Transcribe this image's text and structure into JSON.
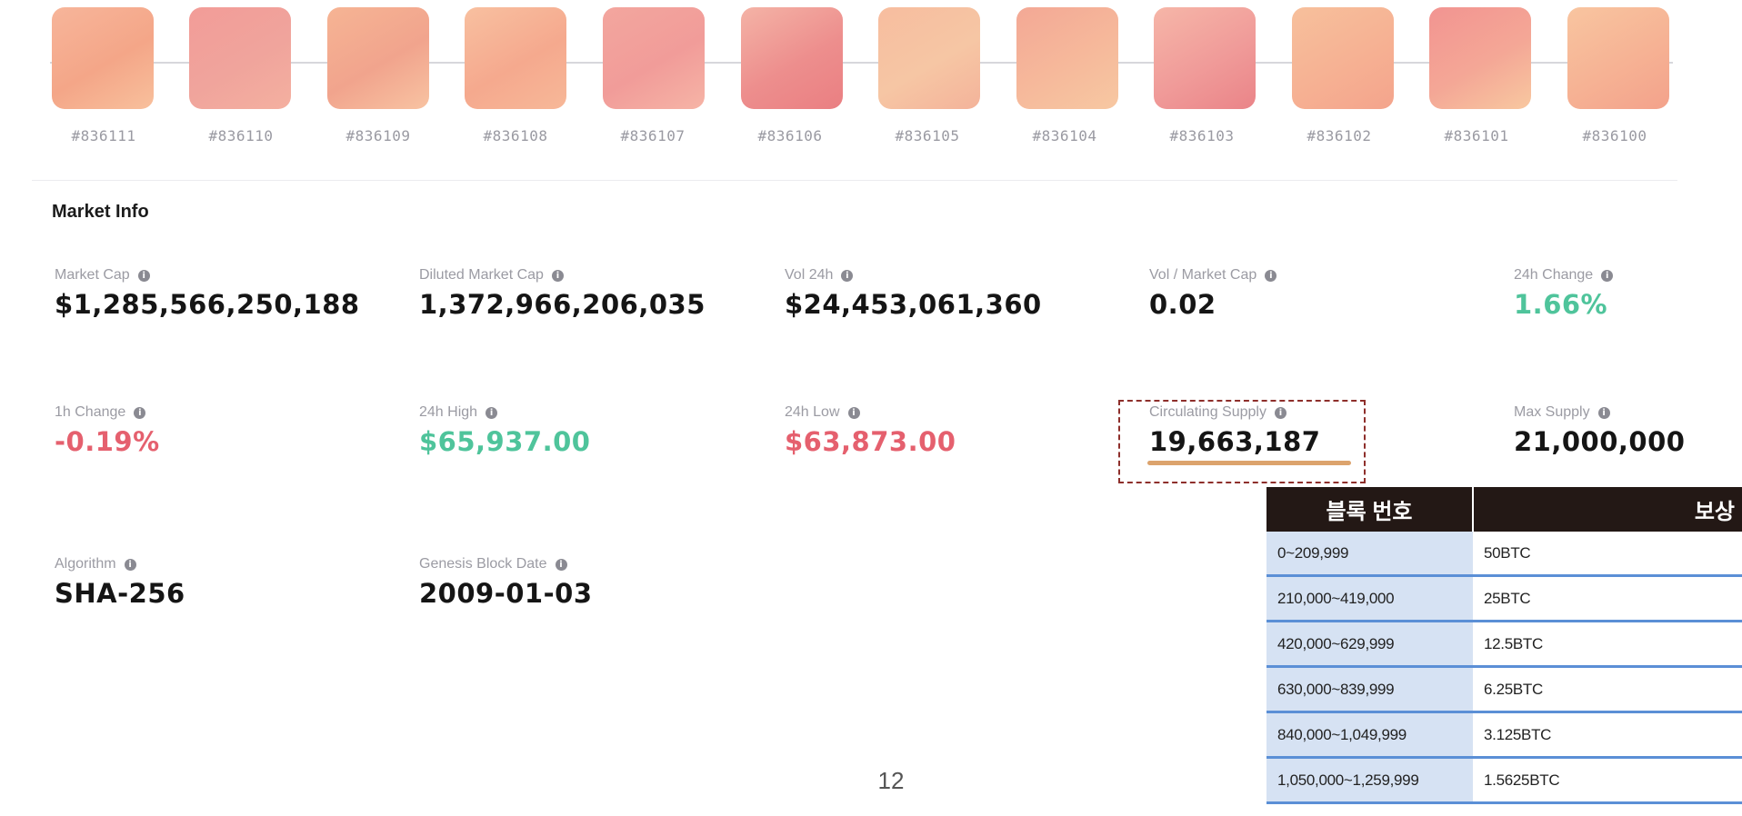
{
  "colors": {
    "swatch_line": "#d7d7dc",
    "positive": "#4fc49b",
    "negative": "#e5606e",
    "highlight_border": "#8e2f2b",
    "supply_bar": "#dca36d",
    "table_header_bg": "#231815",
    "table_block_bg": "#d6e2f3",
    "table_row_border": "#5b8fd6"
  },
  "swatches": [
    {
      "label": "#836111",
      "gradient": [
        "#f7b59a",
        "#f4a688",
        "#f8c09c"
      ]
    },
    {
      "label": "#836110",
      "gradient": [
        "#f29c98",
        "#f0a49c",
        "#f4b0a0"
      ]
    },
    {
      "label": "#836109",
      "gradient": [
        "#f6b494",
        "#f1a48d",
        "#f8c3a2"
      ]
    },
    {
      "label": "#836108",
      "gradient": [
        "#f8c0a0",
        "#f5a98e",
        "#f7b898"
      ]
    },
    {
      "label": "#836107",
      "gradient": [
        "#f3a69e",
        "#f19c99",
        "#f6b4a6"
      ]
    },
    {
      "label": "#836106",
      "gradient": [
        "#f4b3a6",
        "#ed8e8d",
        "#ea7f82"
      ]
    },
    {
      "label": "#836105",
      "gradient": [
        "#f7bd9f",
        "#f6c6a4",
        "#f4b39a"
      ]
    },
    {
      "label": "#836104",
      "gradient": [
        "#f3a895",
        "#f6b99b",
        "#f7c8a2"
      ]
    },
    {
      "label": "#836103",
      "gradient": [
        "#f6b6a8",
        "#f09b99",
        "#ea8488"
      ]
    },
    {
      "label": "#836102",
      "gradient": [
        "#f7c09c",
        "#f6b193",
        "#f4a48c"
      ]
    },
    {
      "label": "#836101",
      "gradient": [
        "#f29491",
        "#f4a796",
        "#f8c8a0"
      ]
    },
    {
      "label": "#836100",
      "gradient": [
        "#f8c5a0",
        "#f6b294",
        "#f3a28b"
      ]
    }
  ],
  "market_info": {
    "title": "Market Info",
    "stats": [
      {
        "label": "Market Cap",
        "value": "$1,285,566,250,188",
        "tone": "default"
      },
      {
        "label": "Diluted Market Cap",
        "value": "1,372,966,206,035",
        "tone": "default"
      },
      {
        "label": "Vol 24h",
        "value": "$24,453,061,360",
        "tone": "default"
      },
      {
        "label": "Vol / Market Cap",
        "value": "0.02",
        "tone": "default"
      },
      {
        "label": "24h Change",
        "value": "1.66%",
        "tone": "positive"
      },
      {
        "label": "1h Change",
        "value": "-0.19%",
        "tone": "negative"
      },
      {
        "label": "24h High",
        "value": "$65,937.00",
        "tone": "positive"
      },
      {
        "label": "24h Low",
        "value": "$63,873.00",
        "tone": "negative"
      },
      {
        "label": "Circulating Supply",
        "value": "19,663,187",
        "tone": "default"
      },
      {
        "label": "Max Supply",
        "value": "21,000,000",
        "tone": "default"
      },
      {
        "label": "Algorithm",
        "value": "SHA-256",
        "tone": "default"
      },
      {
        "label": "Genesis Block Date",
        "value": "2009-01-03",
        "tone": "default"
      }
    ]
  },
  "reward_table": {
    "headers": [
      "블록 번호",
      "보상"
    ],
    "rows": [
      {
        "block": "0~209,999",
        "reward": "50BTC"
      },
      {
        "block": "210,000~419,000",
        "reward": "25BTC"
      },
      {
        "block": "420,000~629,999",
        "reward": "12.5BTC"
      },
      {
        "block": "630,000~839,999",
        "reward": "6.25BTC"
      },
      {
        "block": "840,000~1,049,999",
        "reward": "3.125BTC"
      },
      {
        "block": "1,050,000~1,259,999",
        "reward": "1.5625BTC"
      }
    ]
  },
  "page_number": "12"
}
